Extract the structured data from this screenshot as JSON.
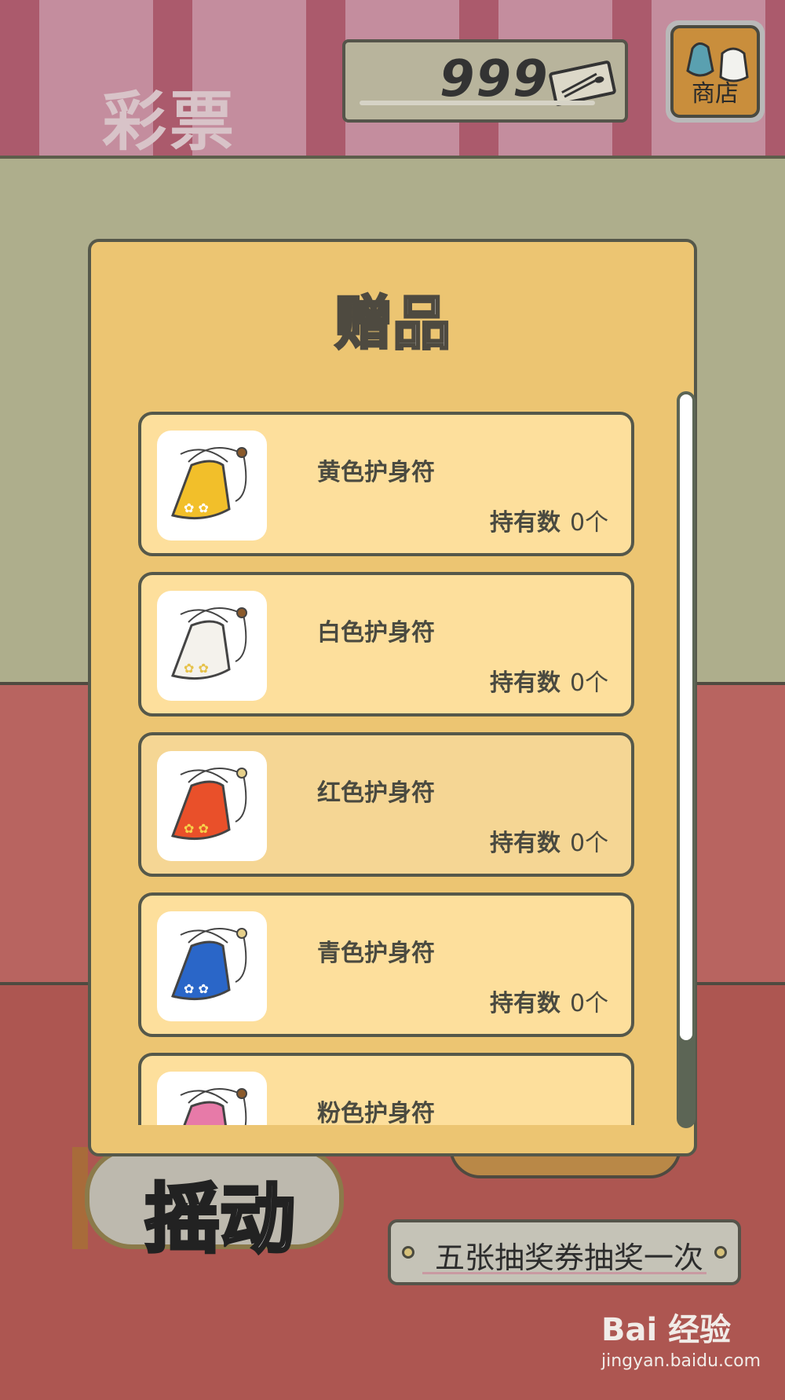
{
  "header": {
    "title": "彩票",
    "ticket_count": "999",
    "shop_label": "商店"
  },
  "popup": {
    "title": "赠品",
    "count_label": "持有数",
    "items": [
      {
        "name": "黄色护身符",
        "count": "0个",
        "color": "#f2bf2a"
      },
      {
        "name": "白色护身符",
        "count": "0个",
        "color": "#f4f2ec"
      },
      {
        "name": "红色护身符",
        "count": "0个",
        "color": "#e9502a"
      },
      {
        "name": "青色护身符",
        "count": "0个",
        "color": "#2a66c8"
      },
      {
        "name": "粉色护身符",
        "count": "",
        "color": "#e77aa8"
      }
    ]
  },
  "controls": {
    "shake_label": "摇动",
    "draw_label": "五张抽奖券抽奖一次"
  },
  "watermark": {
    "logo": "Bai 经验",
    "url": "jingyan.baidu.com"
  }
}
